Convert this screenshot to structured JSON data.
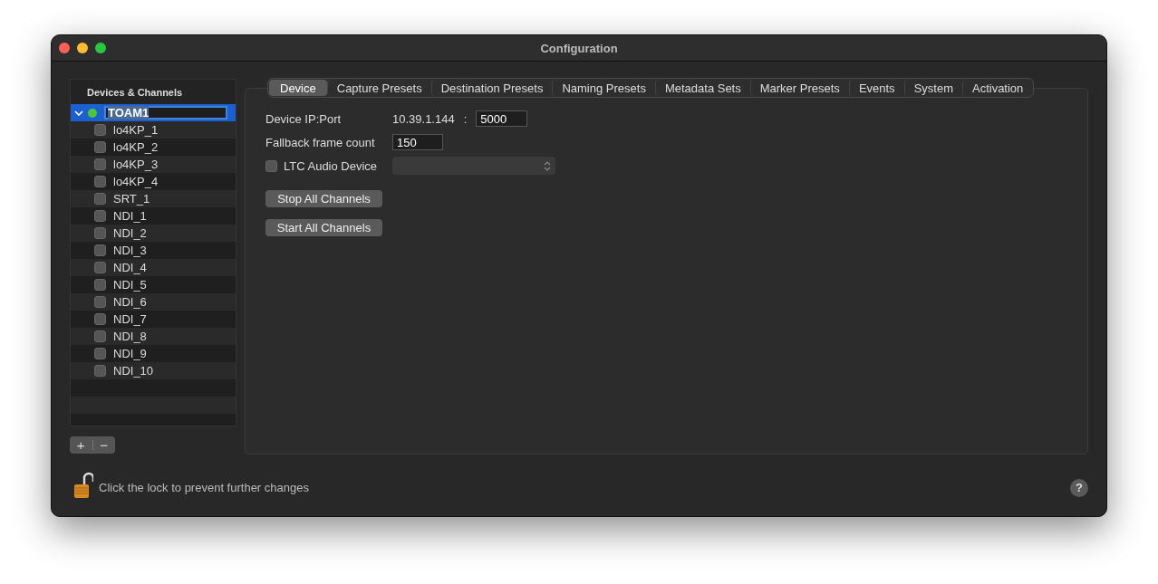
{
  "window": {
    "title": "Configuration"
  },
  "sidebar": {
    "header": "Devices & Channels",
    "device": {
      "name": "TOAM1",
      "expanded": true,
      "selected": true,
      "color": "#4cc832",
      "children": [
        {
          "name": "lo4KP_1",
          "checked": false
        },
        {
          "name": "lo4KP_2",
          "checked": false
        },
        {
          "name": "lo4KP_3",
          "checked": false
        },
        {
          "name": "lo4KP_4",
          "checked": false
        },
        {
          "name": "SRT_1",
          "checked": false
        },
        {
          "name": "NDI_1",
          "checked": false
        },
        {
          "name": "NDI_2",
          "checked": false
        },
        {
          "name": "NDI_3",
          "checked": false
        },
        {
          "name": "NDI_4",
          "checked": false
        },
        {
          "name": "NDI_5",
          "checked": false
        },
        {
          "name": "NDI_6",
          "checked": false
        },
        {
          "name": "NDI_7",
          "checked": false
        },
        {
          "name": "NDI_8",
          "checked": false
        },
        {
          "name": "NDI_9",
          "checked": false
        },
        {
          "name": "NDI_10",
          "checked": false
        }
      ]
    },
    "add_button": "+",
    "remove_button": "−"
  },
  "tabs": [
    {
      "label": "Device",
      "selected": true
    },
    {
      "label": "Capture Presets",
      "selected": false
    },
    {
      "label": "Destination Presets",
      "selected": false
    },
    {
      "label": "Naming Presets",
      "selected": false
    },
    {
      "label": "Metadata Sets",
      "selected": false
    },
    {
      "label": "Marker Presets",
      "selected": false
    },
    {
      "label": "Events",
      "selected": false
    },
    {
      "label": "System",
      "selected": false
    },
    {
      "label": "Activation",
      "selected": false
    }
  ],
  "device_form": {
    "ip_label": "Device IP:Port",
    "ip": "10.39.1.144",
    "separator": ":",
    "port": "5000",
    "fallback_label": "Fallback frame count",
    "fallback": "150",
    "ltc": {
      "label": "LTC Audio Device",
      "checked": false
    },
    "buttons": [
      "Stop All Channels",
      "Start All Channels"
    ]
  },
  "footer": {
    "lock_text": "Click the lock to prevent further changes",
    "help": "?"
  }
}
